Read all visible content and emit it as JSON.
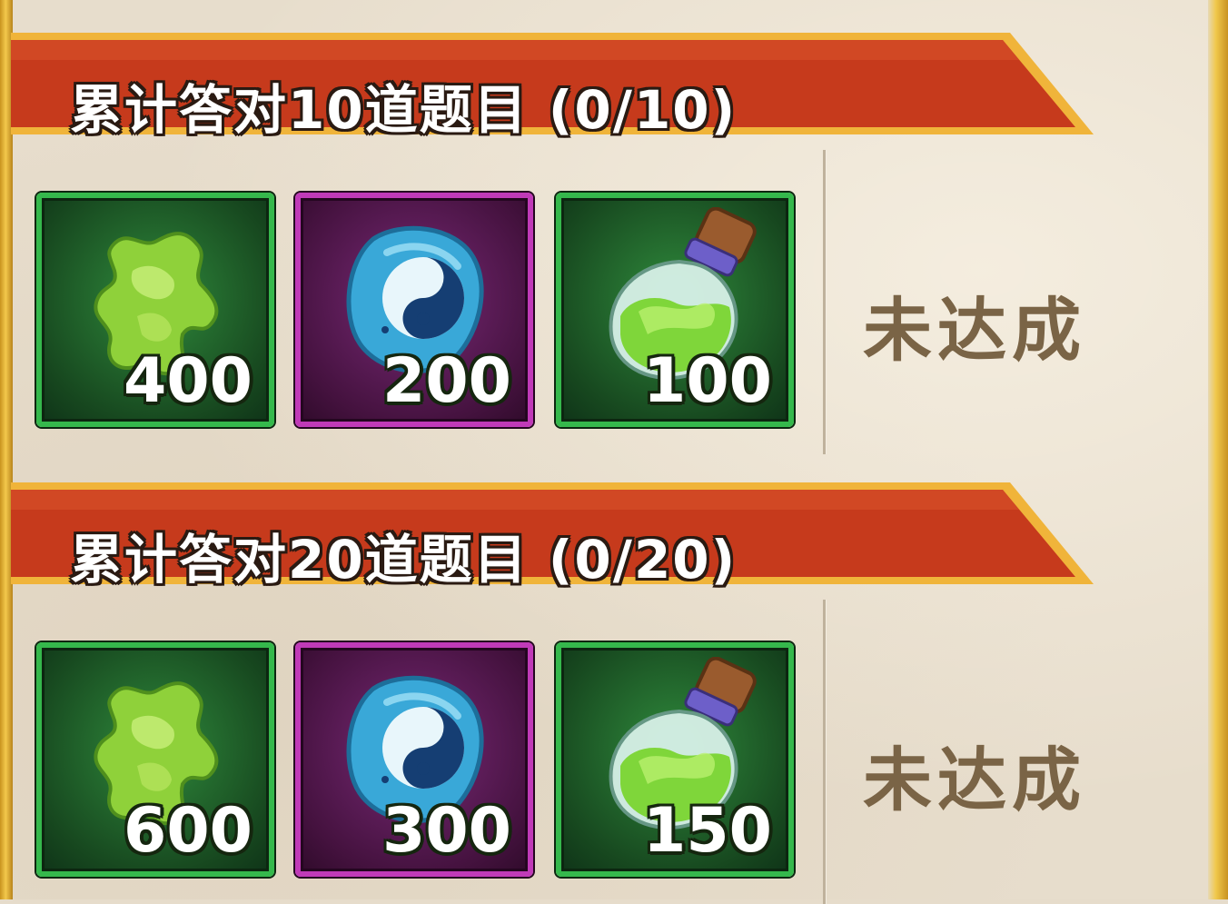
{
  "colors": {
    "banner_red": "#c63a1c",
    "banner_gold": "#f0b43a",
    "slot_green_border": "#35b84c",
    "slot_purple_border": "#c03ab8",
    "status_text": "#7a6446",
    "parchment": "#e7ddcc"
  },
  "tasks": [
    {
      "title": "累计答对10道题目 (0/10)",
      "rewards": [
        {
          "icon": "green-spirit-fragment-icon",
          "quantity": "400"
        },
        {
          "icon": "yin-yang-stone-icon",
          "quantity": "200"
        },
        {
          "icon": "green-potion-bottle-icon",
          "quantity": "100"
        }
      ],
      "status": "未达成"
    },
    {
      "title": "累计答对20道题目 (0/20)",
      "rewards": [
        {
          "icon": "green-spirit-fragment-icon",
          "quantity": "600"
        },
        {
          "icon": "yin-yang-stone-icon",
          "quantity": "300"
        },
        {
          "icon": "green-potion-bottle-icon",
          "quantity": "150"
        }
      ],
      "status": "未达成"
    }
  ]
}
